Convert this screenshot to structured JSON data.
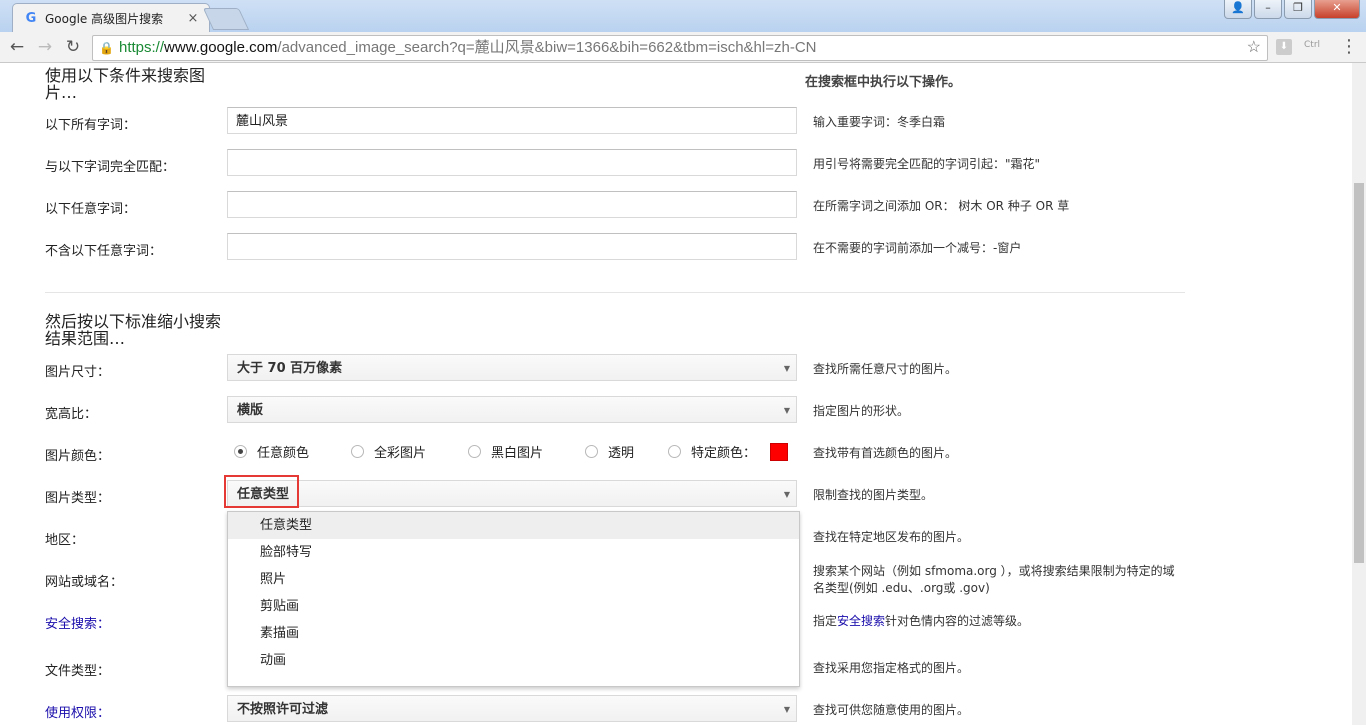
{
  "browser": {
    "tab_title": "Google 高级图片搜索",
    "tab_close": "×",
    "url_https": "https://",
    "url_host": "www.google.com",
    "url_rest": "/advanced_image_search?q=麓山风景&biw=1366&bih=662&tbm=isch&hl=zh-CN",
    "ext_label": "Ctrl"
  },
  "section1": {
    "title": "使用以下条件来搜索图片…",
    "hint": "在搜索框中执行以下操作。",
    "rows": [
      {
        "label": "以下所有字词：",
        "value": "麓山风景",
        "help": "输入重要字词：冬季白霜"
      },
      {
        "label": "与以下字词完全匹配：",
        "value": "",
        "help": "用引号将需要完全匹配的字词引起：\"霜花\""
      },
      {
        "label": "以下任意字词：",
        "value": "",
        "help": "在所需字词之间添加 OR： 树木 OR 种子 OR 草"
      },
      {
        "label": "不含以下任意字词：",
        "value": "",
        "help": "在不需要的字词前添加一个减号：-窗户"
      }
    ]
  },
  "section2": {
    "title": "然后按以下标准缩小搜索结果范围…",
    "size": {
      "label": "图片尺寸：",
      "value": "大于 70 百万像素",
      "help": "查找所需任意尺寸的图片。"
    },
    "aspect": {
      "label": "宽高比：",
      "value": "横版",
      "help": "指定图片的形状。"
    },
    "color": {
      "label": "图片颜色：",
      "options": [
        "任意颜色",
        "全彩图片",
        "黑白图片",
        "透明",
        "特定颜色："
      ],
      "selected": "任意颜色",
      "swatch": "#ff0000",
      "help": "查找带有首选颜色的图片。"
    },
    "type": {
      "label": "图片类型：",
      "value": "任意类型",
      "help": "限制查找的图片类型。"
    },
    "region": {
      "label": "地区：",
      "help": "查找在特定地区发布的图片。"
    },
    "site": {
      "label": "网站或域名：",
      "help": "搜索某个网站（例如 sfmoma.org ），或将搜索结果限制为特定的域名类型(例如 .edu、.org或 .gov)"
    },
    "safe": {
      "label": "安全搜索：",
      "help_pre": "指定",
      "help_link": "安全搜索",
      "help_post": "针对色情内容的过滤等级。"
    },
    "filetype": {
      "label": "文件类型：",
      "help": "查找采用您指定格式的图片。"
    },
    "rights": {
      "label": "使用权限：",
      "value": "不按照许可过滤",
      "help": "查找可供您随意使用的图片。"
    }
  },
  "dropdown": {
    "items": [
      "任意类型",
      "脸部特写",
      "照片",
      "剪贴画",
      "素描画",
      "动画"
    ],
    "active": "任意类型"
  }
}
